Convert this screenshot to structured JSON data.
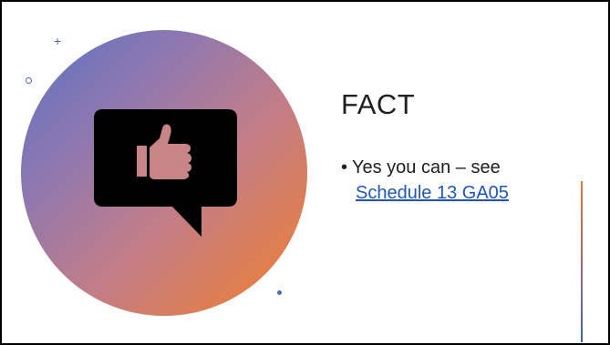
{
  "slide": {
    "title": "FACT",
    "bullet": {
      "marker": "•",
      "text": "Yes you can – see",
      "link_text": "Schedule 13 GA05"
    }
  },
  "decorations": {
    "plus_glyph": "+",
    "icon": "thumbs-up-speech-bubble-icon"
  },
  "colors": {
    "gradient_start": "#5a72c4",
    "gradient_end": "#ea7d3e",
    "link": "#1f55c0",
    "accent_blue": "#4a6bbd",
    "accent_orange": "#e67a2c"
  }
}
